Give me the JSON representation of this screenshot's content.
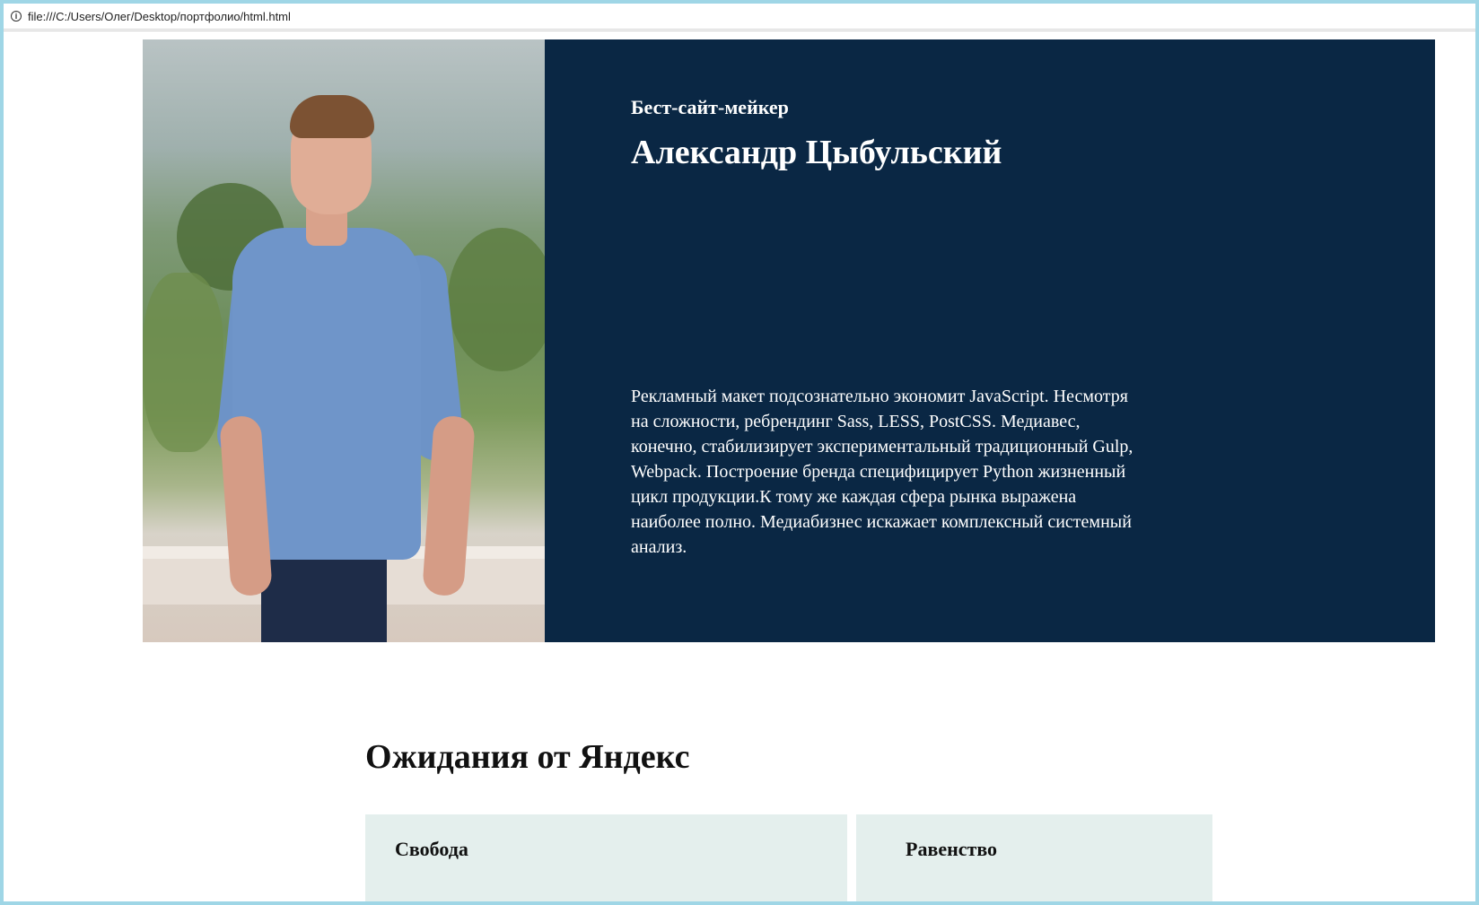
{
  "browser": {
    "url": "file:///C:/Users/Олег/Desktop/портфолио/html.html",
    "info_icon": "info-icon"
  },
  "hero": {
    "subtitle": "Бест-сайт-мейкер",
    "title": "Александр Цыбульский",
    "description": "Рекламный макет подсознательно экономит JavaScript. Несмотря на сложности, ребрендинг Sass, LESS, PostCSS. Медиавес, конечно, стабилизирует экспериментальный традиционный Gulp, Webpack. Построение бренда специфицирует Python жизненный цикл продукции.К тому же каждая сфера рынка выражена наиболее полно. Медиабизнес искажает комплексный системный анализ.",
    "background_color": "#0a2744"
  },
  "expectations": {
    "title": "Ожидания от Яндекс",
    "cards": [
      {
        "label": "Свобода"
      },
      {
        "label": "Равенство"
      }
    ],
    "card_color": "#e4efed"
  }
}
